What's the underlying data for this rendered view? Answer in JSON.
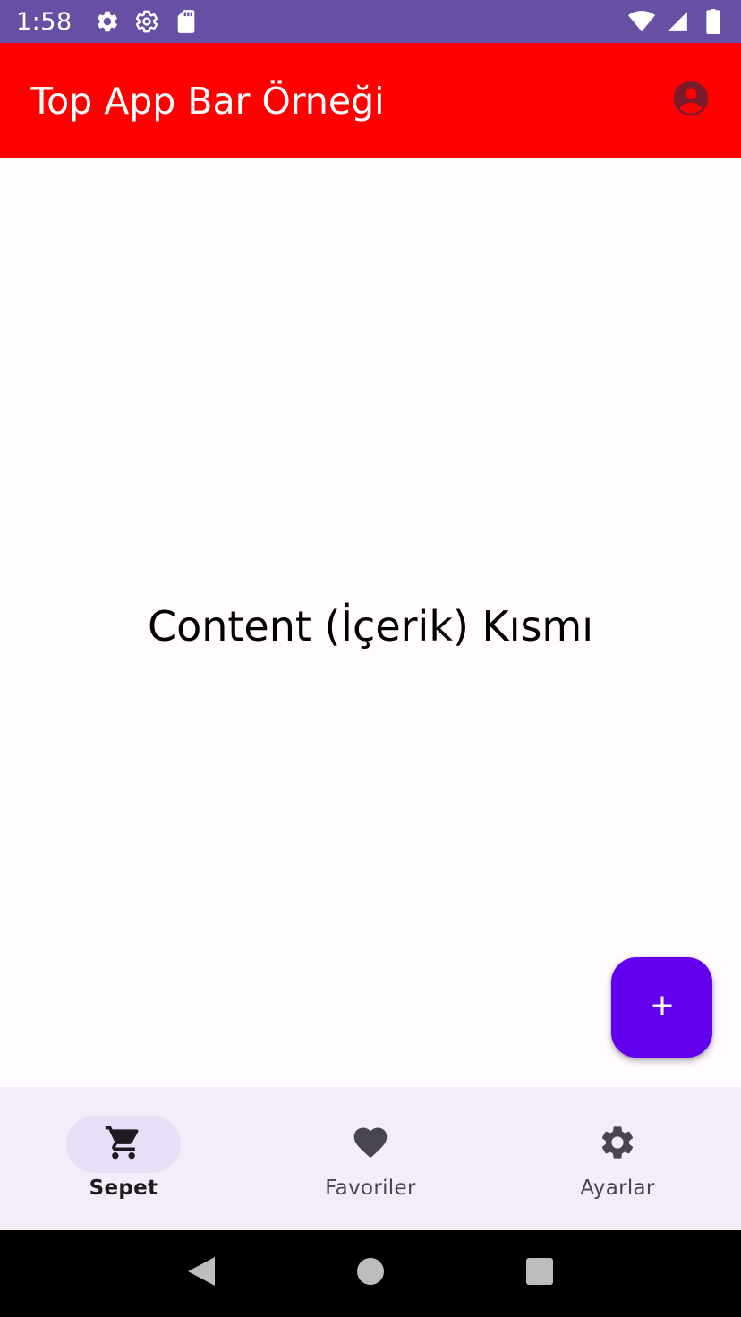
{
  "status_bar": {
    "time": "1:58",
    "left_icons": [
      "gear-icon",
      "gear-outline-icon",
      "sd-card-icon"
    ],
    "right_icons": [
      "wifi-icon",
      "signal-icon",
      "battery-icon"
    ],
    "background": "#6750a4"
  },
  "app_bar": {
    "title": "Top App Bar Örneği",
    "background": "#ff0000",
    "action_icon": "account-circle-icon"
  },
  "content": {
    "text": "Content (İçerik) Kısmı"
  },
  "fab": {
    "icon": "plus-icon",
    "color": "#6200ee"
  },
  "bottom_nav": {
    "items": [
      {
        "label": "Sepet",
        "icon": "shopping-cart-icon",
        "selected": true
      },
      {
        "label": "Favoriler",
        "icon": "heart-icon",
        "selected": false
      },
      {
        "label": "Ayarlar",
        "icon": "settings-icon",
        "selected": false
      }
    ]
  },
  "system_nav": {
    "buttons": [
      "back-icon",
      "home-icon",
      "recents-icon"
    ]
  }
}
